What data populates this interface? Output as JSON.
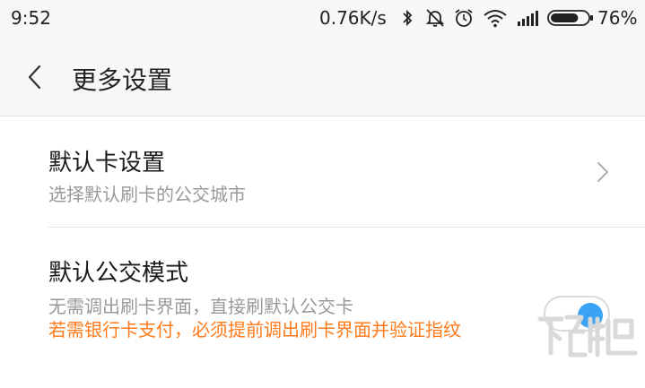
{
  "status_bar": {
    "time": "9:52",
    "network_speed": "0.76K/s",
    "icons": [
      "bluetooth-icon",
      "mute-icon",
      "alarm-icon",
      "wifi-icon",
      "cellular-signal-icon",
      "battery-icon"
    ],
    "battery_percent": "76%",
    "battery_level": 0.76
  },
  "header": {
    "back_icon": "chevron-left-icon",
    "title": "更多设置"
  },
  "settings": {
    "default_card": {
      "title": "默认卡设置",
      "subtitle": "选择默认刷卡的公交城市",
      "icon": "chevron-right-icon"
    },
    "default_transit_mode": {
      "title": "默认公交模式",
      "subtitle": "无需调出刷卡界面，直接刷默认公交卡",
      "warning": "若需银行卡支付，必须提前调出刷卡界面并验证指纹",
      "toggle_on": true,
      "toggle_color": "#3aa3f5"
    }
  },
  "colors": {
    "warning": "#ff7a1a",
    "accent": "#3aa3f5"
  }
}
